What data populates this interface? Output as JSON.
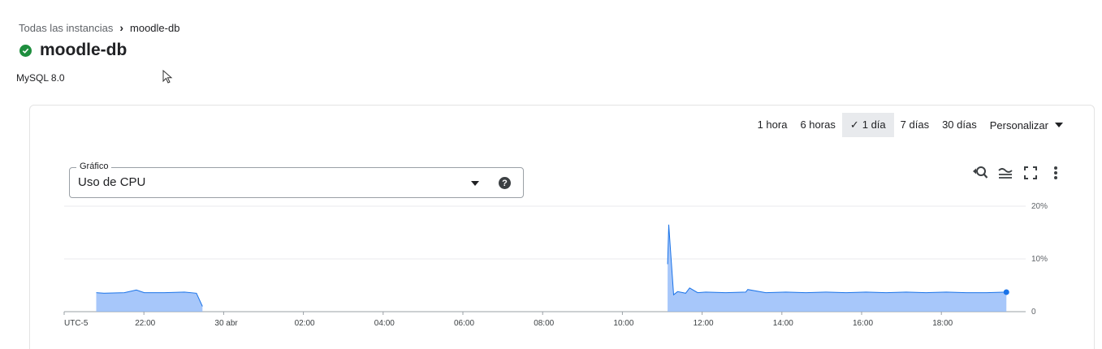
{
  "breadcrumb": {
    "parent": "Todas las instancias",
    "current": "moodle-db"
  },
  "instance": {
    "name": "moodle-db",
    "version": "MySQL 8.0",
    "status_color": "#1e8e3e"
  },
  "time_ranges": {
    "options": [
      "1 hora",
      "6 horas",
      "1 día",
      "7 días",
      "30 días"
    ],
    "selected": "1 día",
    "custom_label": "Personalizar"
  },
  "chart_selector": {
    "label": "Gráfico",
    "value": "Uso de CPU",
    "help_symbol": "?"
  },
  "chart_tools": [
    "zoom-reset-icon",
    "legend-icon",
    "fullscreen-icon",
    "more-vert-icon"
  ],
  "chart_data": {
    "type": "area",
    "x_labels": [
      "UTC-5",
      "22:00",
      "30 abr",
      "02:00",
      "04:00",
      "06:00",
      "08:00",
      "10:00",
      "12:00",
      "14:00",
      "16:00",
      "18:00"
    ],
    "y_ticks": [
      "0",
      "10%",
      "20%"
    ],
    "ylim": [
      0,
      20
    ],
    "grid": true,
    "color": "#8ab4f8",
    "line_color": "#1a73e8",
    "series": [
      {
        "x": [
          20.8,
          21.0,
          21.5,
          21.8,
          22.0,
          22.5,
          23.0,
          23.3,
          23.45
        ],
        "values": [
          3.6,
          3.5,
          3.6,
          4.1,
          3.6,
          3.6,
          3.7,
          3.5,
          1.0
        ]
      },
      {
        "x": [
          11.05,
          11.08,
          11.12,
          11.2,
          11.3,
          11.5,
          11.6,
          11.8,
          12.0,
          12.5,
          13.0,
          13.05,
          13.5,
          14.0,
          14.5,
          15.0,
          15.5,
          16.0,
          16.5,
          17.0,
          17.5,
          18.0,
          18.5,
          19.0,
          19.5
        ],
        "values": [
          9.0,
          16.5,
          12.0,
          3.2,
          3.8,
          3.5,
          4.5,
          3.6,
          3.7,
          3.6,
          3.7,
          4.2,
          3.6,
          3.7,
          3.6,
          3.7,
          3.6,
          3.7,
          3.6,
          3.7,
          3.6,
          3.7,
          3.6,
          3.6,
          3.7
        ]
      }
    ]
  }
}
